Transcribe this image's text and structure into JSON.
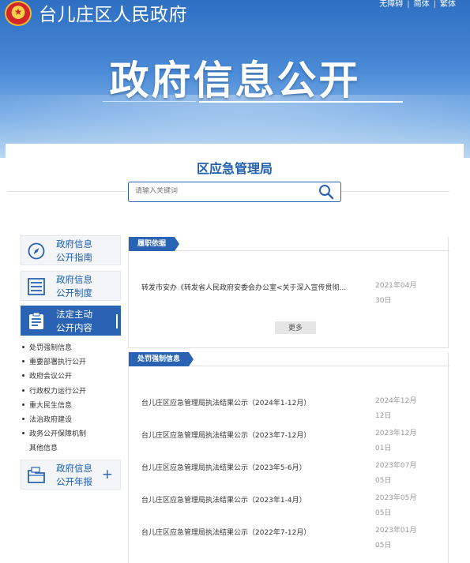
{
  "header": {
    "site_name": "台儿庄区人民政府",
    "emblem_glyph": "★",
    "links": [
      "无障碍",
      "简体",
      "繁体"
    ],
    "link_sep": "|",
    "banner_title": "政府信息公开"
  },
  "org": {
    "title": "区应急管理局"
  },
  "search": {
    "placeholder": "请输入关键词",
    "icon": "search-icon"
  },
  "sidebar": {
    "items": [
      {
        "line1": "政府信息",
        "line2": "公开指南",
        "icon": "compass-icon"
      },
      {
        "line1": "政府信息",
        "line2": "公开制度",
        "icon": "list-document-icon"
      },
      {
        "line1": "法定主动",
        "line2": "公开内容",
        "icon": "clipboard-icon",
        "active": true
      },
      {
        "line1": "政府信息",
        "line2": "公开年报",
        "icon": "folder-icon",
        "expand": "+"
      }
    ],
    "sub_items": [
      "处罚强制信息",
      "重要部署执行公开",
      "政府会议公开",
      "行政权力运行公开",
      "重大民生信息",
      "法治政府建设",
      "政务公开保障机制",
      "其他信息"
    ]
  },
  "panels": {
    "duty": {
      "tag": "履职依据",
      "rows": [
        {
          "title": "转发市安办《转发省人民政府安委会办公室<关于深入宣传贯彻...",
          "date_line1": "2021年04月",
          "date_line2": "30日"
        }
      ],
      "more_label": "更多"
    },
    "penalty": {
      "tag": "处罚强制信息",
      "rows": [
        {
          "title": "台儿庄区应急管理局执法结果公示（2024年1-12月）",
          "date_line1": "2024年12月",
          "date_line2": "12日"
        },
        {
          "title": "台儿庄区应急管理局执法结果公示（2023年7-12月）",
          "date_line1": "2023年12月",
          "date_line2": "01日"
        },
        {
          "title": "台儿庄区应急管理局执法结果公示（2023年5-6月）",
          "date_line1": "2023年07月",
          "date_line2": "05日"
        },
        {
          "title": "台儿庄区应急管理局执法结果公示（2023年1-4月）",
          "date_line1": "2023年05月",
          "date_line2": "05日"
        },
        {
          "title": "台儿庄区应急管理局执法结果公示（2022年7-12月）",
          "date_line1": "2023年01月",
          "date_line2": "05日"
        }
      ]
    }
  },
  "colors": {
    "brand_blue": "#2a63b4",
    "title_blue": "#1f5fae",
    "date_gray": "#999999"
  }
}
